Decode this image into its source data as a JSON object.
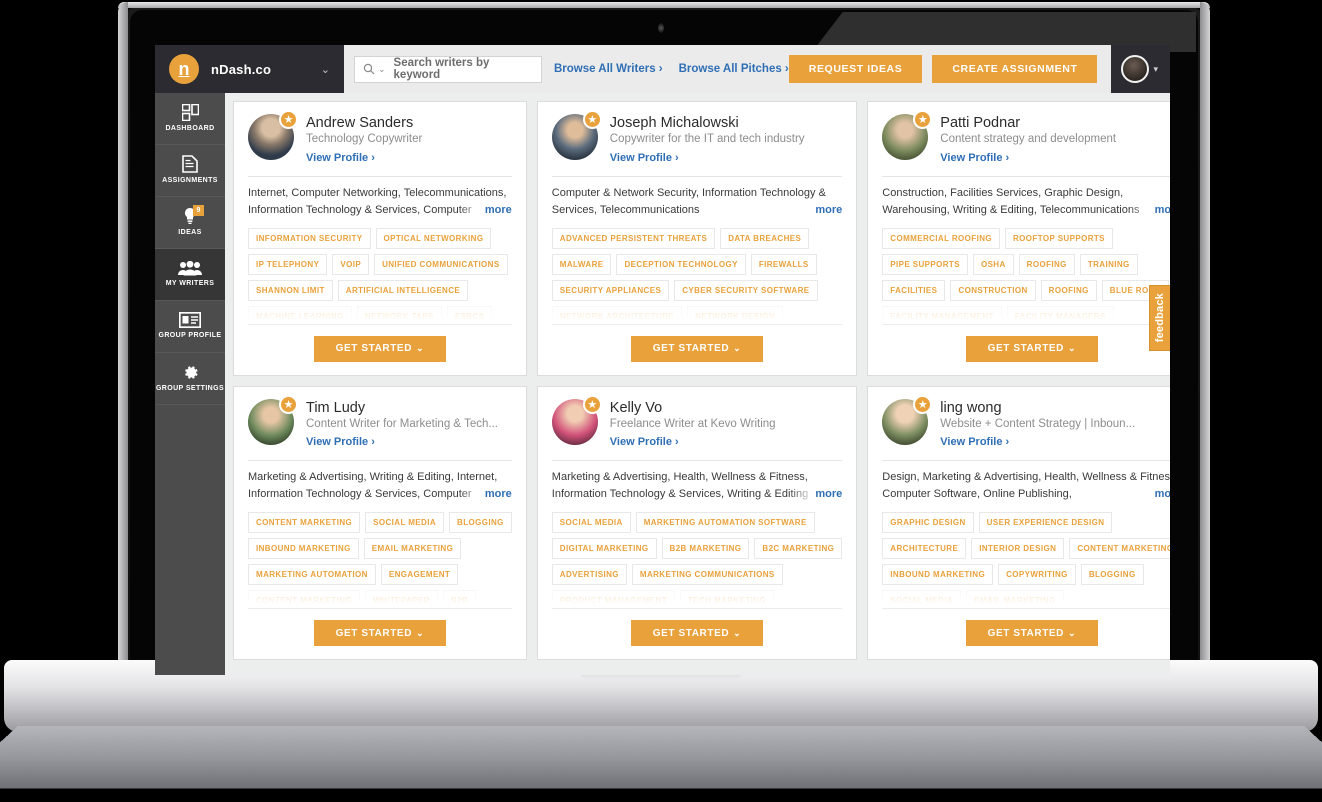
{
  "brand": {
    "logo_letter": "n",
    "name": "nDash.co",
    "caret": "⌄"
  },
  "search": {
    "placeholder": "Search writers by keyword",
    "icon": "search-icon",
    "caret": "⌄"
  },
  "nav_links": [
    {
      "label": "Browse All Writers ›"
    },
    {
      "label": "Browse All Pitches ›"
    }
  ],
  "nav_buttons": [
    {
      "label": "REQUEST IDEAS"
    },
    {
      "label": "CREATE ASSIGNMENT"
    }
  ],
  "account": {
    "caret": "▾"
  },
  "sidebar": {
    "items": [
      {
        "label": "DASHBOARD",
        "icon": "dashboard-icon",
        "active": false,
        "badge": ""
      },
      {
        "label": "ASSIGNMENTS",
        "icon": "document-icon",
        "active": false,
        "badge": ""
      },
      {
        "label": "IDEAS",
        "icon": "lightbulb-icon",
        "active": false,
        "badge": "9"
      },
      {
        "label": "MY WRITERS",
        "icon": "people-icon",
        "active": true,
        "badge": ""
      },
      {
        "label": "GROUP PROFILE",
        "icon": "id-card-icon",
        "active": false,
        "badge": ""
      },
      {
        "label": "GROUP SETTINGS",
        "icon": "gear-icon",
        "active": false,
        "badge": ""
      }
    ]
  },
  "labels": {
    "view_profile": "View Profile ›",
    "more": "more",
    "get_started": "GET STARTED",
    "get_started_caret": "⌄",
    "feedback": "feedback"
  },
  "colors": {
    "accent": "#e9a13b",
    "link": "#2f6fb5",
    "sidebar": "#4c4c4c",
    "topbar_dark": "#2b2b31"
  },
  "writers": [
    {
      "name": "Andrew Sanders",
      "title": "Technology Copywriter",
      "industries": "Internet, Computer Networking, Telecommunications, Information Technology & Services, Computer Software",
      "tag_rows": [
        [
          "INFORMATION SECURITY",
          "OPTICAL NETWORKING"
        ],
        [
          "IP TELEPHONY",
          "VOIP",
          "UNIFIED COMMUNICATIONS"
        ],
        [
          "SHANNON LIMIT",
          "ARTIFICIAL INTELLIGENCE"
        ],
        [
          "MACHINE LEARNING",
          "NETWORK TAPS",
          "ESBCS"
        ]
      ]
    },
    {
      "name": "Joseph Michalowski",
      "title": "Copywriter for the IT and tech industry",
      "industries": "Computer & Network Security, Information Technology & Services, Telecommunications",
      "tag_rows": [
        [
          "ADVANCED PERSISTENT THREATS",
          "DATA BREACHES"
        ],
        [
          "MALWARE",
          "DECEPTION TECHNOLOGY",
          "FIREWALLS"
        ],
        [
          "SECURITY APPLIANCES",
          "CYBER SECURITY SOFTWARE"
        ],
        [
          "NETWORK ARCHITECTURE",
          "NETWORK DESIGN"
        ]
      ]
    },
    {
      "name": "Patti Podnar",
      "title": "Content strategy and development",
      "industries": "Construction, Facilities Services, Graphic Design, Warehousing, Writing & Editing, Telecommunications",
      "tag_rows": [
        [
          "COMMERCIAL ROOFING",
          "ROOFTOP SUPPORTS"
        ],
        [
          "PIPE SUPPORTS",
          "OSHA",
          "ROOFING",
          "TRAINING"
        ],
        [
          "FACILITIES",
          "CONSTRUCTION",
          "ROOFING",
          "BLUE ROOF"
        ],
        [
          "FACILITY MANAGEMENT",
          "FACILITY MANAGERS"
        ]
      ]
    },
    {
      "name": "Tim Ludy",
      "title": "Content Writer for Marketing & Tech...",
      "industries": "Marketing & Advertising, Writing & Editing, Internet, Information Technology & Services, Computer Software",
      "tag_rows": [
        [
          "CONTENT MARKETING",
          "SOCIAL MEDIA",
          "BLOGGING"
        ],
        [
          "INBOUND MARKETING",
          "EMAIL MARKETING"
        ],
        [
          "MARKETING AUTOMATION",
          "ENGAGEMENT"
        ],
        [
          "CONTENT MARKETING",
          "WHITEPAPER",
          "B2B"
        ]
      ]
    },
    {
      "name": "Kelly Vo",
      "title": "Freelance Writer at Kevo Writing",
      "industries": "Marketing & Advertising, Health, Wellness & Fitness, Information Technology & Services, Writing & Editing",
      "tag_rows": [
        [
          "SOCIAL MEDIA",
          "MARKETING AUTOMATION SOFTWARE"
        ],
        [
          "DIGITAL MARKETING",
          "B2B MARKETING",
          "B2C MARKETING"
        ],
        [
          "ADVERTISING",
          "MARKETING COMMUNICATIONS"
        ],
        [
          "PRODUCT MANAGEMENT",
          "TECH MARKETING"
        ]
      ]
    },
    {
      "name": "ling wong",
      "title": "Website + Content Strategy | Inboun...",
      "industries": "Design, Marketing & Advertising, Health, Wellness & Fitness, Computer Software, Online Publishing,",
      "tag_rows": [
        [
          "GRAPHIC DESIGN",
          "USER EXPERIENCE DESIGN"
        ],
        [
          "ARCHITECTURE",
          "INTERIOR DESIGN",
          "CONTENT MARKETING"
        ],
        [
          "INBOUND MARKETING",
          "COPYWRITING",
          "BLOGGING"
        ],
        [
          "SOCIAL MEDIA",
          "EMAIL MARKETING"
        ]
      ]
    }
  ]
}
